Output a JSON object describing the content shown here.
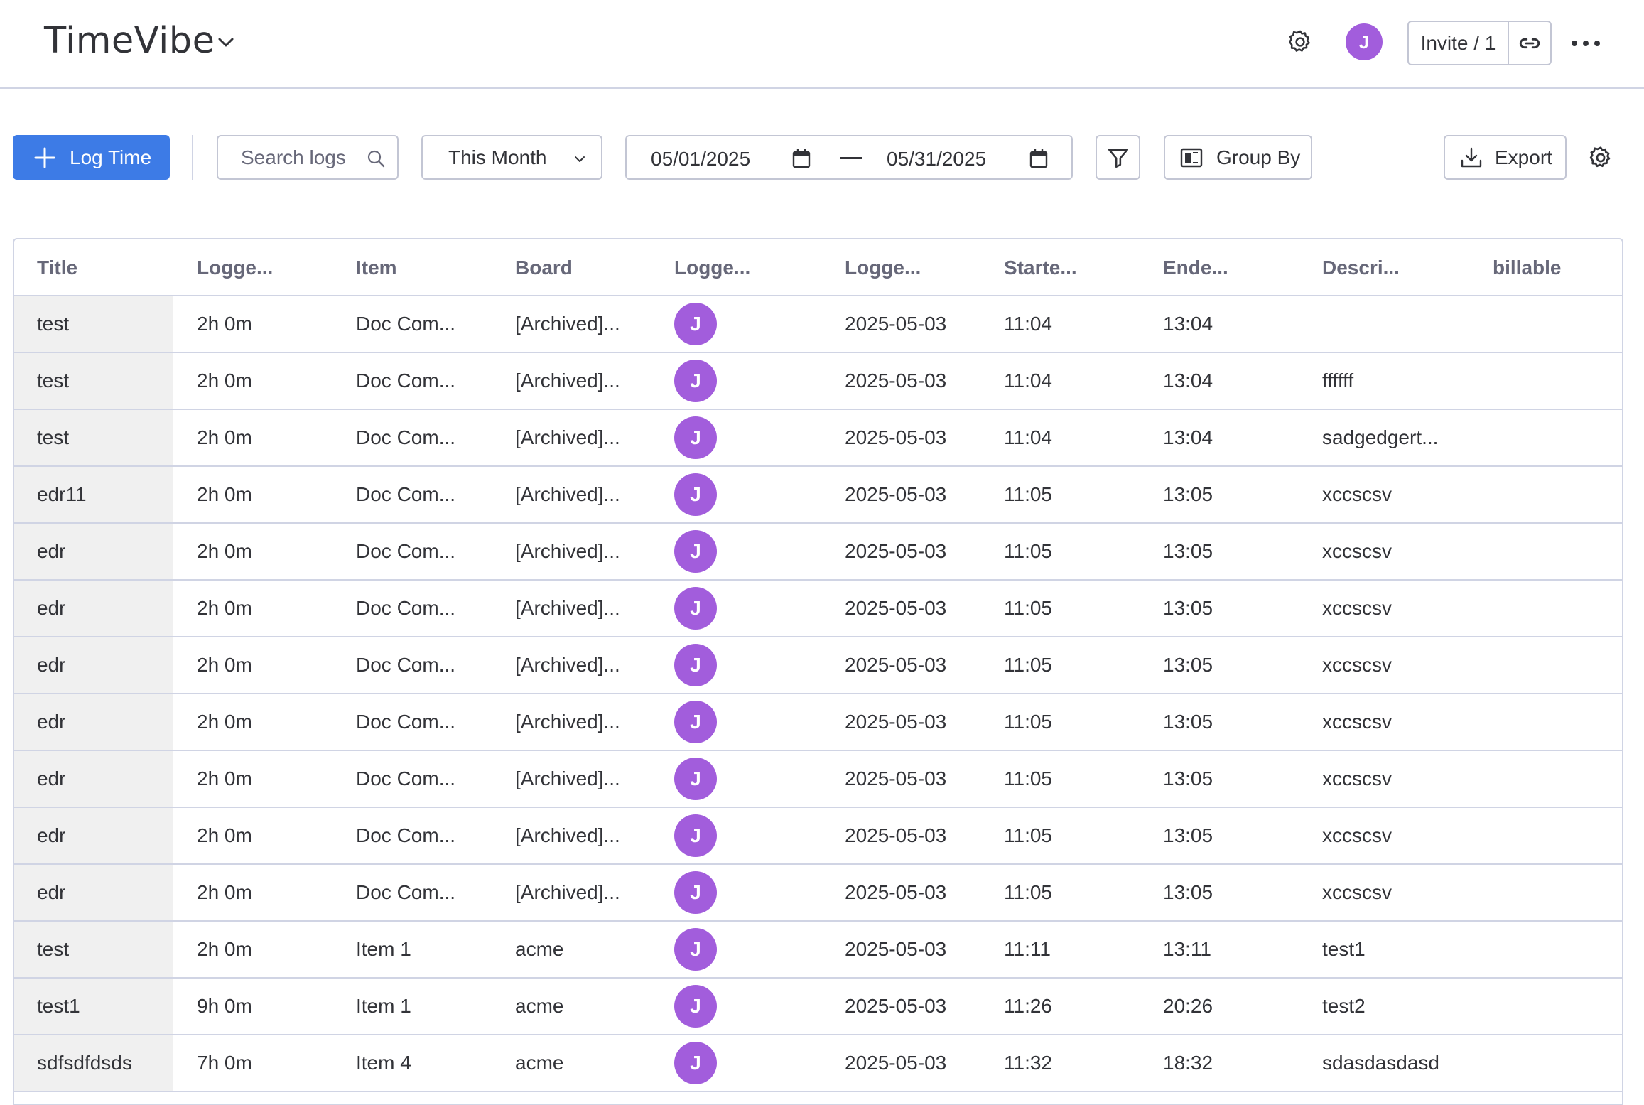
{
  "header": {
    "app_title": "TimeVibe",
    "avatar_initial": "J",
    "invite_label": "Invite / 1",
    "accent_color": "#a25ddc"
  },
  "toolbar": {
    "log_time_label": "Log Time",
    "search_placeholder": "Search logs",
    "period_value": "This Month",
    "date_from": "05/01/2025",
    "date_to": "05/31/2025",
    "group_by_label": "Group By",
    "export_label": "Export",
    "primary_color": "#3d7be6"
  },
  "table": {
    "columns": [
      "Title",
      "Logge...",
      "Item",
      "Board",
      "Logge...",
      "Logge...",
      "Starte...",
      "Ende...",
      "Descri...",
      "billable"
    ],
    "rows": [
      {
        "title": "test",
        "duration": "2h 0m",
        "item": "Doc Com...",
        "board": "[Archived]...",
        "user": "J",
        "date": "2025-05-03",
        "start": "11:04",
        "end": "13:04",
        "description": "",
        "billable": ""
      },
      {
        "title": "test",
        "duration": "2h 0m",
        "item": "Doc Com...",
        "board": "[Archived]...",
        "user": "J",
        "date": "2025-05-03",
        "start": "11:04",
        "end": "13:04",
        "description": "ffffff",
        "billable": ""
      },
      {
        "title": "test",
        "duration": "2h 0m",
        "item": "Doc Com...",
        "board": "[Archived]...",
        "user": "J",
        "date": "2025-05-03",
        "start": "11:04",
        "end": "13:04",
        "description": "sadgedgert...",
        "billable": ""
      },
      {
        "title": "edr11",
        "duration": "2h 0m",
        "item": "Doc Com...",
        "board": "[Archived]...",
        "user": "J",
        "date": "2025-05-03",
        "start": "11:05",
        "end": "13:05",
        "description": "xccscsv",
        "billable": ""
      },
      {
        "title": "edr",
        "duration": "2h 0m",
        "item": "Doc Com...",
        "board": "[Archived]...",
        "user": "J",
        "date": "2025-05-03",
        "start": "11:05",
        "end": "13:05",
        "description": "xccscsv",
        "billable": ""
      },
      {
        "title": "edr",
        "duration": "2h 0m",
        "item": "Doc Com...",
        "board": "[Archived]...",
        "user": "J",
        "date": "2025-05-03",
        "start": "11:05",
        "end": "13:05",
        "description": "xccscsv",
        "billable": ""
      },
      {
        "title": "edr",
        "duration": "2h 0m",
        "item": "Doc Com...",
        "board": "[Archived]...",
        "user": "J",
        "date": "2025-05-03",
        "start": "11:05",
        "end": "13:05",
        "description": "xccscsv",
        "billable": ""
      },
      {
        "title": "edr",
        "duration": "2h 0m",
        "item": "Doc Com...",
        "board": "[Archived]...",
        "user": "J",
        "date": "2025-05-03",
        "start": "11:05",
        "end": "13:05",
        "description": "xccscsv",
        "billable": ""
      },
      {
        "title": "edr",
        "duration": "2h 0m",
        "item": "Doc Com...",
        "board": "[Archived]...",
        "user": "J",
        "date": "2025-05-03",
        "start": "11:05",
        "end": "13:05",
        "description": "xccscsv",
        "billable": ""
      },
      {
        "title": "edr",
        "duration": "2h 0m",
        "item": "Doc Com...",
        "board": "[Archived]...",
        "user": "J",
        "date": "2025-05-03",
        "start": "11:05",
        "end": "13:05",
        "description": "xccscsv",
        "billable": ""
      },
      {
        "title": "edr",
        "duration": "2h 0m",
        "item": "Doc Com...",
        "board": "[Archived]...",
        "user": "J",
        "date": "2025-05-03",
        "start": "11:05",
        "end": "13:05",
        "description": "xccscsv",
        "billable": ""
      },
      {
        "title": "test",
        "duration": "2h 0m",
        "item": "Item 1",
        "board": "acme",
        "user": "J",
        "date": "2025-05-03",
        "start": "11:11",
        "end": "13:11",
        "description": "test1",
        "billable": ""
      },
      {
        "title": "test1",
        "duration": "9h 0m",
        "item": "Item 1",
        "board": "acme",
        "user": "J",
        "date": "2025-05-03",
        "start": "11:26",
        "end": "20:26",
        "description": "test2",
        "billable": ""
      },
      {
        "title": "sdfsdfdsds",
        "duration": "7h 0m",
        "item": "Item 4",
        "board": "acme",
        "user": "J",
        "date": "2025-05-03",
        "start": "11:32",
        "end": "18:32",
        "description": "sdasdasdasd",
        "billable": ""
      }
    ]
  }
}
